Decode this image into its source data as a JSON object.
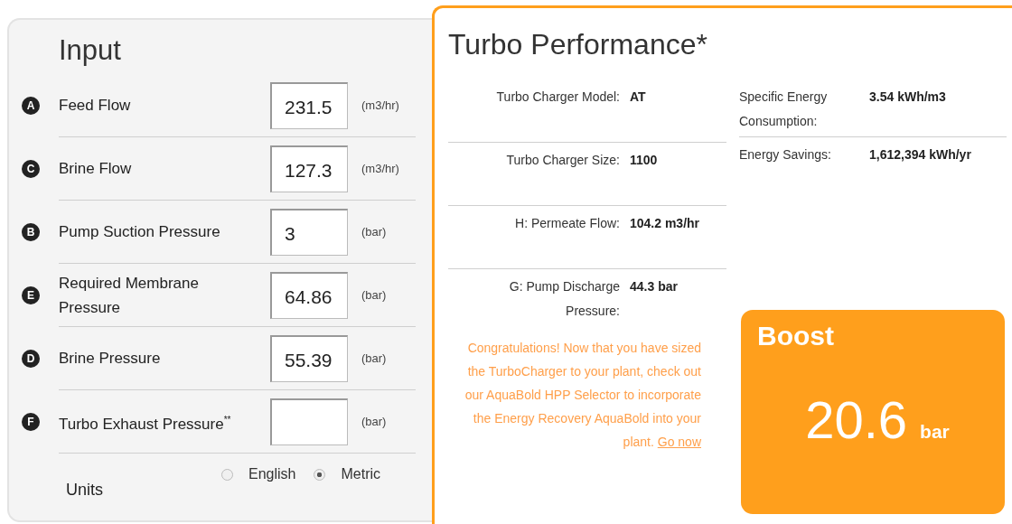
{
  "input_panel": {
    "title": "Input",
    "fields": [
      {
        "badge": "A",
        "label": "Feed Flow",
        "value": "231.5",
        "unit": "(m3/hr)"
      },
      {
        "badge": "C",
        "label": "Brine Flow",
        "value": "127.3",
        "unit": "(m3/hr)"
      },
      {
        "badge": "B",
        "label": "Pump Suction Pressure",
        "value": "3",
        "unit": "(bar)"
      },
      {
        "badge": "E",
        "label": "Required Membrane Pressure",
        "value": "64.86",
        "unit": "(bar)"
      },
      {
        "badge": "D",
        "label": "Brine Pressure",
        "value": "55.39",
        "unit": "(bar)"
      },
      {
        "badge": "F",
        "label": "Turbo Exhaust Pressure$^{**}$",
        "unit": "(bar)"
      }
    ],
    "units": {
      "label": "Units",
      "options": [
        {
          "label": "English",
          "selected": false
        },
        {
          "label": "Metric",
          "selected": true
        }
      ]
    }
  },
  "performance_panel": {
    "title": "Turbo Performance*",
    "left_items": [
      {
        "label": "Turbo Charger Model:",
        "value": "AT"
      },
      {
        "label": "Turbo Charger Size:",
        "value": "1100"
      },
      {
        "label": "H: Permeate Flow:",
        "value": "104.2 m3/hr"
      },
      {
        "label": "G: Pump Discharge Pressure:",
        "value": "44.3 bar"
      }
    ],
    "right_items": [
      {
        "label": "Specific Energy Consumption:",
        "value": "3.54 kWh/m3"
      },
      {
        "label": "Energy Savings:",
        "value": "1,612,394 kWh/yr"
      }
    ],
    "message": "Congratulations! Now that you have sized the TurboCharger to your plant, check out our AquaBold HPP Selector to incorporate the Energy Recovery AquaBold into your plant.",
    "message_link": "Go now",
    "boost": {
      "title": "Boost",
      "value": "20.6",
      "unit": "bar"
    }
  }
}
